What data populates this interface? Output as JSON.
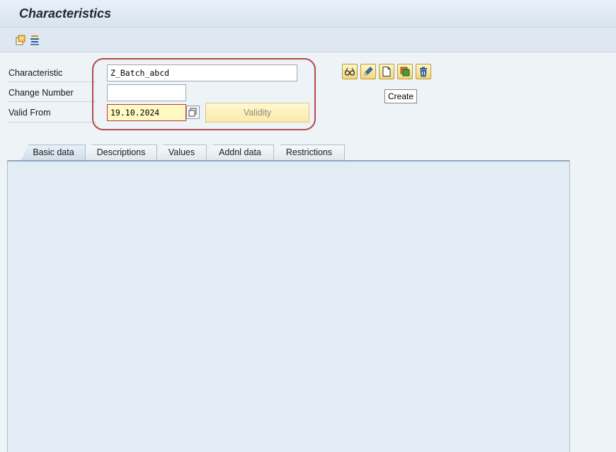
{
  "window": {
    "title": "Characteristics"
  },
  "toolbar": {
    "icons": [
      "other-object-icon",
      "display-list-icon"
    ]
  },
  "form": {
    "characteristic": {
      "label": "Characteristic",
      "value": "Z_Batch_abcd"
    },
    "change_number": {
      "label": "Change Number",
      "value": ""
    },
    "valid_from": {
      "label": "Valid From",
      "value": "19.10.2024"
    },
    "validity_button": "Validity"
  },
  "actions": {
    "icons": [
      "display-icon",
      "change-pencil-icon",
      "create-icon",
      "copy-icon",
      "delete-icon"
    ],
    "tooltip": "Create"
  },
  "tabs": [
    "Basic data",
    "Descriptions",
    "Values",
    "Addnl data",
    "Restrictions"
  ],
  "active_tab": "Basic data",
  "colors": {
    "highlight_ring": "#b54b4b",
    "required_field": "#fff9c4",
    "panel": "#e3ecf4"
  }
}
